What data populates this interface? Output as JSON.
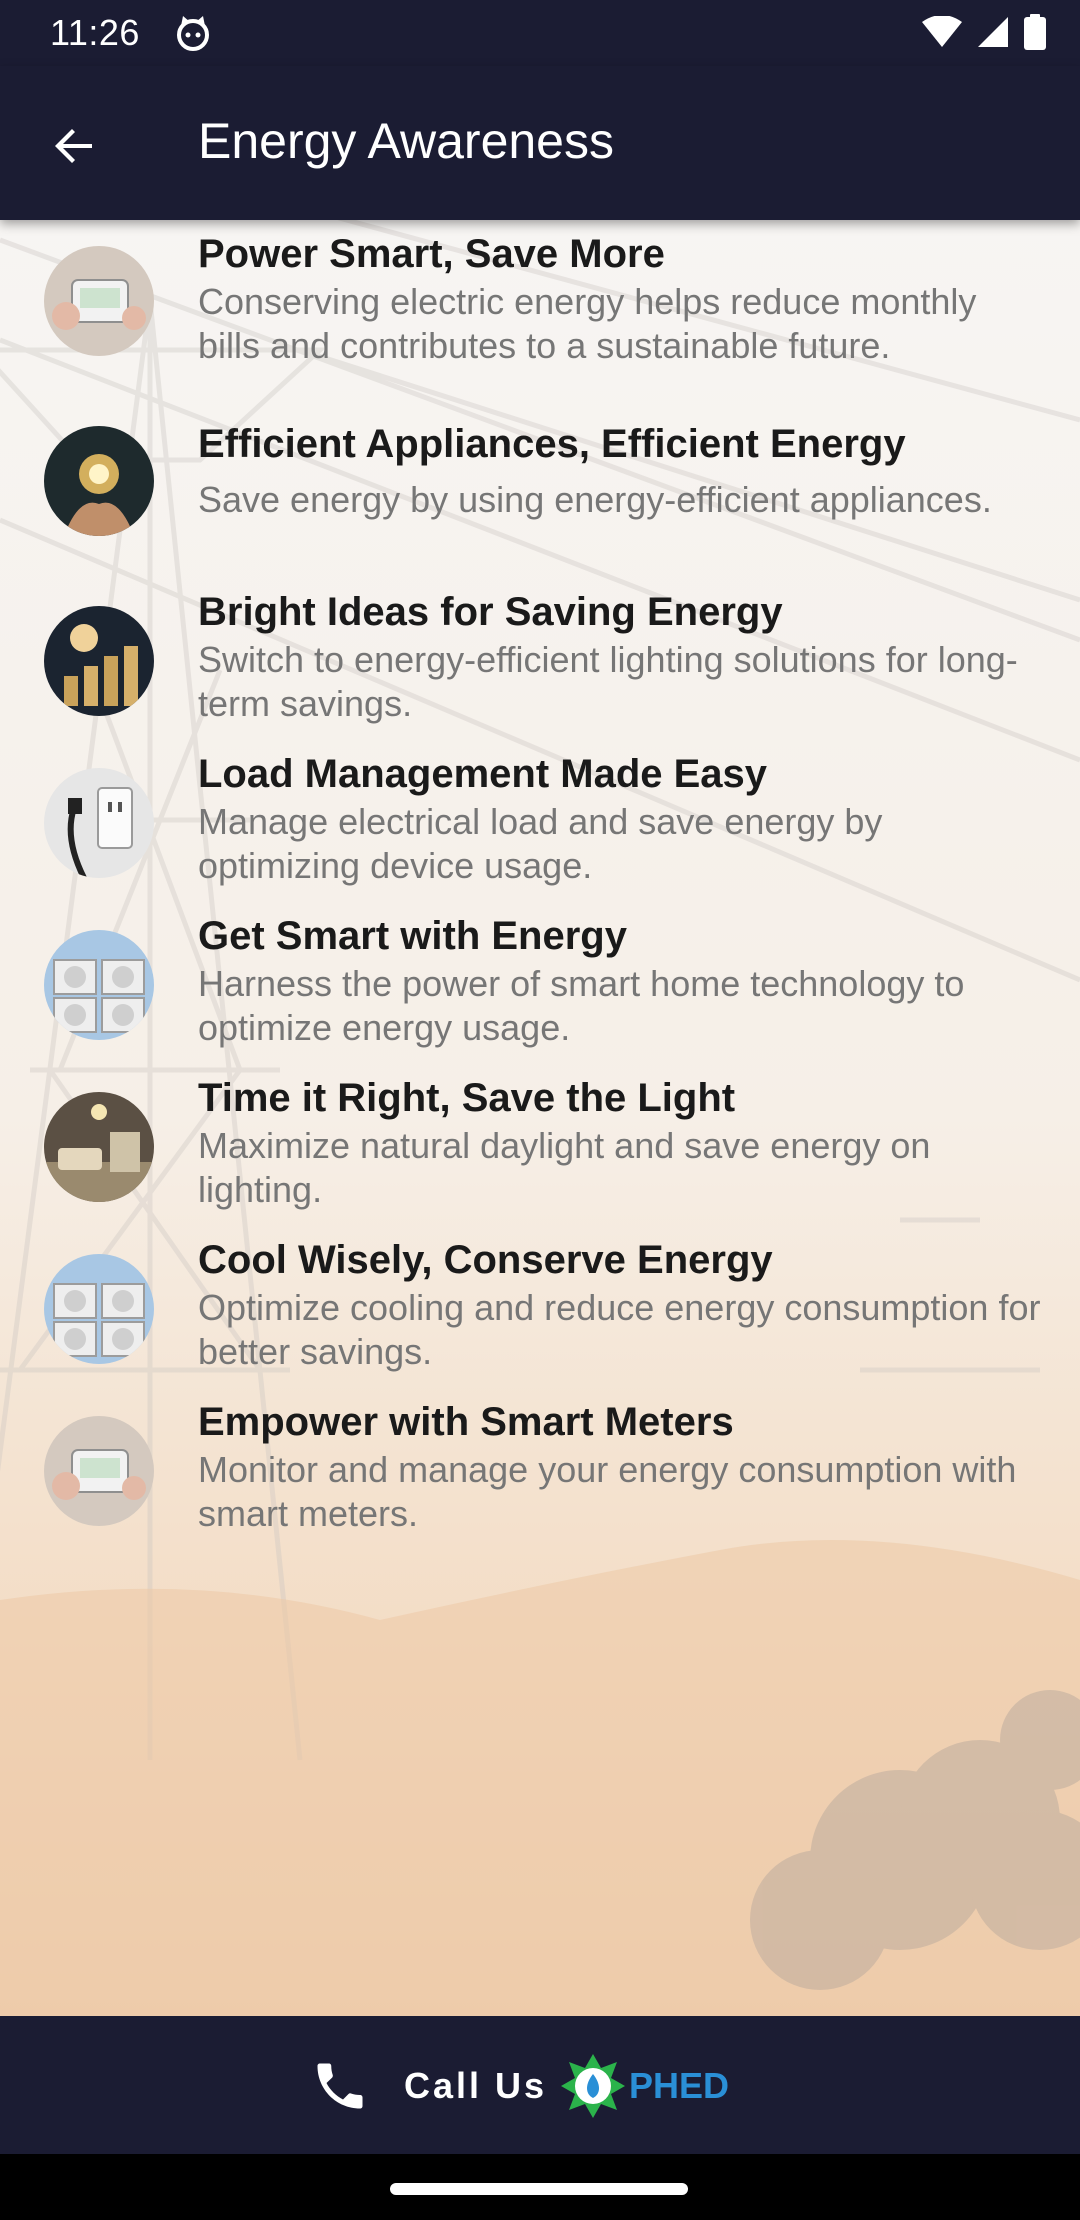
{
  "status": {
    "time": "11:26"
  },
  "app_bar": {
    "title": "Energy Awareness",
    "back_icon": "arrow-back-icon"
  },
  "items": [
    {
      "title": "Power Smart, Save More",
      "description": "Conserving electric energy helps reduce monthly bills and contributes to a sustainable future.",
      "image": "smart-thermostat-thumbnail"
    },
    {
      "title": "Efficient Appliances, Efficient Energy",
      "description": "Save energy by using energy-efficient appliances.",
      "image": "glowing-bulb-hands-thumbnail"
    },
    {
      "title": "Bright Ideas for Saving Energy",
      "description": "Switch to energy-efficient lighting solutions for long-term savings.",
      "image": "coins-bulb-thumbnail"
    },
    {
      "title": "Load Management Made Easy",
      "description": "Manage electrical load and save energy by optimizing device usage.",
      "image": "wall-outlet-thumbnail"
    },
    {
      "title": "Get Smart with Energy",
      "description": "Harness the power of smart home technology to optimize energy usage.",
      "image": "ac-units-thumbnail"
    },
    {
      "title": "Time it Right, Save the Light",
      "description": "Maximize natural daylight and save energy on lighting.",
      "image": "living-room-thumbnail"
    },
    {
      "title": "Cool Wisely, Conserve Energy",
      "description": "Optimize cooling and reduce energy consumption for better savings.",
      "image": "ac-units-thumbnail"
    },
    {
      "title": "Empower with Smart Meters",
      "description": "Monitor and manage your energy consumption with smart meters.",
      "image": "smart-thermostat-thumbnail"
    }
  ],
  "bottom_bar": {
    "call_label": "Call Us",
    "phone_icon": "phone-icon",
    "logo_text": "PHED"
  },
  "colors": {
    "app_bar": "#1b1c33",
    "title_text": "#1a1a1a",
    "description_text": "#767676",
    "logo_green": "#2bb34b",
    "logo_blue": "#2a8fd6"
  }
}
